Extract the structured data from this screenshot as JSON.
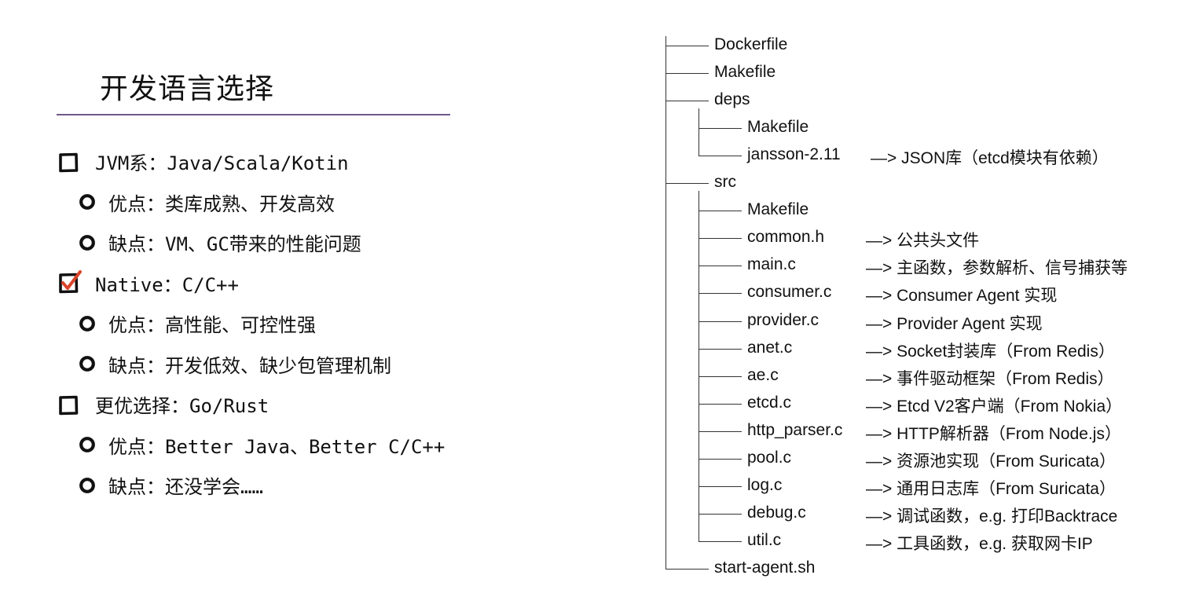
{
  "slide": {
    "title": "开发语言选择",
    "accent_color": "#6f5a8a",
    "check_color": "#d9442a"
  },
  "bullets": [
    {
      "level": 1,
      "icon": "square-checkbox-icon",
      "text": "JVM系：Java/Scala/Kotin"
    },
    {
      "level": 2,
      "icon": "circle-bullet-icon",
      "text": "优点：类库成熟、开发高效"
    },
    {
      "level": 2,
      "icon": "circle-bullet-icon",
      "text": "缺点：VM、GC带来的性能问题"
    },
    {
      "level": 1,
      "icon": "checked-checkbox-icon",
      "text": "Native：C/C++"
    },
    {
      "level": 2,
      "icon": "circle-bullet-icon",
      "text": "优点：高性能、可控性强"
    },
    {
      "level": 2,
      "icon": "circle-bullet-icon",
      "text": "缺点：开发低效、缺少包管理机制"
    },
    {
      "level": 1,
      "icon": "square-checkbox-icon",
      "text": "更优选择：Go/Rust"
    },
    {
      "level": 2,
      "icon": "circle-bullet-icon",
      "text": "优点：Better Java、Better C/C++"
    },
    {
      "level": 2,
      "icon": "circle-bullet-icon",
      "text": "缺点：还没学会……"
    }
  ],
  "tree": [
    {
      "depth": 0,
      "name": "Dockerfile",
      "note": ""
    },
    {
      "depth": 0,
      "name": "Makefile",
      "note": ""
    },
    {
      "depth": 0,
      "name": "deps",
      "note": ""
    },
    {
      "depth": 1,
      "name": "Makefile",
      "note": ""
    },
    {
      "depth": 1,
      "name": "jansson-2.11",
      "note": "—>  JSON库（etcd模块有依赖）"
    },
    {
      "depth": 0,
      "name": "src",
      "note": ""
    },
    {
      "depth": 1,
      "name": "Makefile",
      "note": ""
    },
    {
      "depth": 1,
      "name": "common.h",
      "note": "—>  公共头文件"
    },
    {
      "depth": 1,
      "name": "main.c",
      "note": "—>  主函数，参数解析、信号捕获等"
    },
    {
      "depth": 1,
      "name": "consumer.c",
      "note": "—>  Consumer Agent 实现"
    },
    {
      "depth": 1,
      "name": "provider.c",
      "note": "—>  Provider Agent 实现"
    },
    {
      "depth": 1,
      "name": "anet.c",
      "note": "—>  Socket封装库（From Redis）"
    },
    {
      "depth": 1,
      "name": "ae.c",
      "note": "—>  事件驱动框架（From Redis）"
    },
    {
      "depth": 1,
      "name": "etcd.c",
      "note": "—>  Etcd V2客户端（From Nokia）"
    },
    {
      "depth": 1,
      "name": "http_parser.c",
      "note": "—>  HTTP解析器（From Node.js）"
    },
    {
      "depth": 1,
      "name": "pool.c",
      "note": "—>  资源池实现（From Suricata）"
    },
    {
      "depth": 1,
      "name": "log.c",
      "note": "—>  通用日志库（From Suricata）"
    },
    {
      "depth": 1,
      "name": "debug.c",
      "note": "—>  调试函数，e.g. 打印Backtrace"
    },
    {
      "depth": 1,
      "name": "util.c",
      "note": "—> 工具函数，e.g. 获取网卡IP"
    },
    {
      "depth": 0,
      "name": "start-agent.sh",
      "note": ""
    }
  ]
}
